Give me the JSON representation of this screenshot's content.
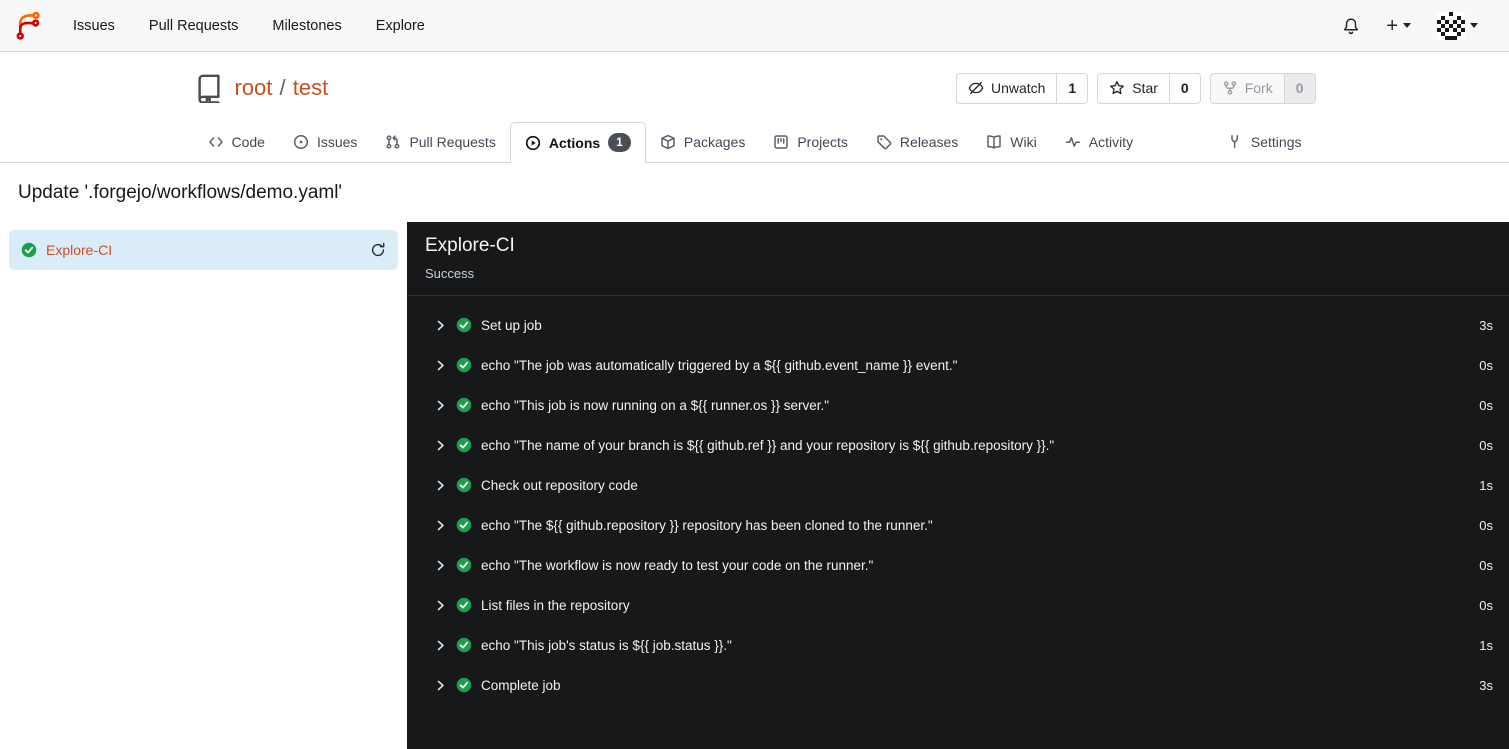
{
  "navbar": {
    "items": [
      "Issues",
      "Pull Requests",
      "Milestones",
      "Explore"
    ],
    "right_icons": [
      "bell-icon",
      "plus-icon",
      "caret-down-icon",
      "avatar-identicon",
      "caret-down-icon"
    ]
  },
  "repo_header": {
    "icon": "repo-book-icon",
    "owner": "root",
    "separator": "/",
    "name": "test",
    "actions": [
      {
        "label": "Unwatch",
        "count": "1",
        "icon": "eye-slash-icon",
        "disabled": false
      },
      {
        "label": "Star",
        "count": "0",
        "icon": "star-icon",
        "disabled": false
      },
      {
        "label": "Fork",
        "count": "0",
        "icon": "fork-icon",
        "disabled": true
      }
    ],
    "tabs": [
      {
        "label": "Code",
        "icon": "code-icon"
      },
      {
        "label": "Issues",
        "icon": "issue-icon"
      },
      {
        "label": "Pull Requests",
        "icon": "pull-request-icon"
      },
      {
        "label": "Actions",
        "icon": "play-circle-icon",
        "badge": "1",
        "active": true
      },
      {
        "label": "Packages",
        "icon": "package-icon"
      },
      {
        "label": "Projects",
        "icon": "project-icon"
      },
      {
        "label": "Releases",
        "icon": "tag-icon"
      },
      {
        "label": "Wiki",
        "icon": "book-icon"
      },
      {
        "label": "Activity",
        "icon": "pulse-icon"
      },
      {
        "label": "Settings",
        "icon": "tools-icon"
      }
    ]
  },
  "page": {
    "title": "Update '.forgejo/workflows/demo.yaml'"
  },
  "sidebar": {
    "jobs": [
      {
        "name": "Explore-CI",
        "status": "success",
        "selected": true
      }
    ]
  },
  "run_panel": {
    "title": "Explore-CI",
    "status": "Success",
    "steps": [
      {
        "name": "Set up job",
        "duration": "3s"
      },
      {
        "name": "echo \"The job was automatically triggered by a ${{ github.event_name }} event.\"",
        "duration": "0s"
      },
      {
        "name": "echo \"This job is now running on a ${{ runner.os }} server.\"",
        "duration": "0s"
      },
      {
        "name": "echo \"The name of your branch is ${{ github.ref }} and your repository is ${{ github.repository }}.\"",
        "duration": "0s"
      },
      {
        "name": "Check out repository code",
        "duration": "1s"
      },
      {
        "name": "echo \"The ${{ github.repository }} repository has been cloned to the runner.\"",
        "duration": "0s"
      },
      {
        "name": "echo \"The workflow is now ready to test your code on the runner.\"",
        "duration": "0s"
      },
      {
        "name": "List files in the repository",
        "duration": "0s"
      },
      {
        "name": "echo \"This job's status is ${{ job.status }}.\"",
        "duration": "1s"
      },
      {
        "name": "Complete job",
        "duration": "3s"
      }
    ]
  },
  "colors": {
    "brand_orange": "#ff6600",
    "brand_red": "#d40000",
    "link_primary": "#c9501f",
    "success_green": "#1f9d4d",
    "console_bg": "#16181a",
    "selected_job_bg": "#dbecf9",
    "navbar_bg": "#f8f8f8",
    "badge_bg": "#4a4f56"
  }
}
